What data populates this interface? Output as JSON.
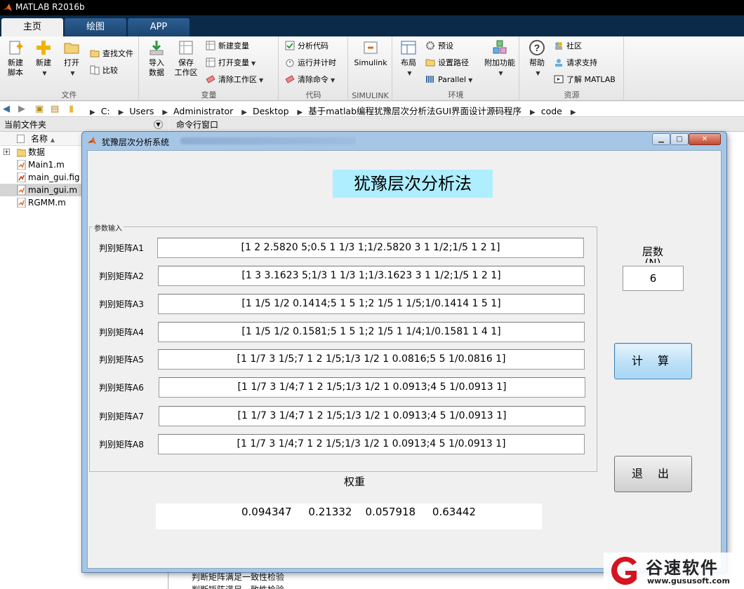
{
  "app": {
    "title": "MATLAB R2016b"
  },
  "tabs": [
    "主页",
    "绘图",
    "APP"
  ],
  "ribbon": {
    "file": {
      "label": "文件",
      "new_script_l1": "新建",
      "new_script_l2": "脚本",
      "new": "新建",
      "open": "打开",
      "find_files": "查找文件",
      "compare": "比较"
    },
    "variable": {
      "label": "变量",
      "import_l1": "导入",
      "import_l2": "数据",
      "save_l1": "保存",
      "save_l2": "工作区",
      "new_variable": "新建变量",
      "open_variable": "打开变量",
      "clear_workspace": "清除工作区"
    },
    "code": {
      "label": "代码",
      "analyze_code": "分析代码",
      "run_and_time": "运行并计时",
      "clear_commands": "清除命令"
    },
    "simulink": {
      "label": "SIMULINK",
      "simulink": "Simulink"
    },
    "environment": {
      "label": "环境",
      "layout": "布局",
      "preferences": "预设",
      "set_path": "设置路径",
      "parallel": "Parallel",
      "addons": "附加功能"
    },
    "resources": {
      "label": "资源",
      "help": "帮助",
      "community": "社区",
      "request_support": "请求支持",
      "learn_matlab": "了解 MATLAB"
    }
  },
  "address": {
    "crumbs": [
      "C:",
      "Users",
      "Administrator",
      "Desktop",
      "基于matlab编程犹豫层次分析法GUI界面设计源码程序",
      "code"
    ]
  },
  "current_folder": {
    "title": "当前文件夹",
    "name_header": "名称",
    "files": [
      {
        "name": "数据",
        "type": "folder"
      },
      {
        "name": "Main1.m",
        "type": "m"
      },
      {
        "name": "main_gui.fig",
        "type": "fig"
      },
      {
        "name": "main_gui.m",
        "type": "m-selected"
      },
      {
        "name": "RGMM.m",
        "type": "m"
      }
    ]
  },
  "command_window": {
    "title": "命令行窗口",
    "lines": [
      "判断矩阵满足一致性检验",
      "判断矩阵满足一致性检验"
    ]
  },
  "gui": {
    "window_title": "犹豫层次分析系统",
    "main_title": "犹豫层次分析法",
    "param_group": "参数输入",
    "matrices": [
      {
        "label": "判别矩阵A1",
        "value": "[1 2 2.5820 5;0.5 1 1/3 1;1/2.5820 3 1 1/2;1/5 1 2 1]"
      },
      {
        "label": "判别矩阵A2",
        "value": "[1 3 3.1623 5;1/3 1 1/3 1;1/3.1623 3 1 1/2;1/5 1 2 1]"
      },
      {
        "label": "判别矩阵A3",
        "value": "[1 1/5 1/2 0.1414;5 1 5 1;2 1/5 1 1/5;1/0.1414 1 5 1]"
      },
      {
        "label": "判别矩阵A4",
        "value": "[1 1/5 1/2 0.1581;5 1 5 1;2 1/5 1 1/4;1/0.1581 1 4 1]"
      },
      {
        "label": "判别矩阵A5",
        "value": "[1 1/7 3 1/5;7 1 2 1/5;1/3 1/2 1 0.0816;5 5 1/0.0816 1]"
      },
      {
        "label": "判别矩阵A6",
        "value": "[1 1/7 3 1/4;7 1 2 1/5;1/3 1/2 1 0.0913;4 5 1/0.0913 1]"
      },
      {
        "label": "判别矩阵A7",
        "value": "[1 1/7 3 1/4;7 1 2 1/5;1/3 1/2 1 0.0913;4 5 1/0.0913 1]"
      },
      {
        "label": "判别矩阵A8",
        "value": "[1 1/7 3 1/4;7 1 2 1/5;1/3 1/2 1 0.0913;4 5 1/0.0913 1]"
      }
    ],
    "layers_label": "层数\n(N)",
    "layers_value": "6",
    "compute_button": "计 算",
    "exit_button": "退 出",
    "weights_label": "权重",
    "weights": "0.094347     0.21332    0.057918     0.63442"
  },
  "watermark": {
    "title": "谷速软件",
    "url": "www.gususoft.com"
  }
}
